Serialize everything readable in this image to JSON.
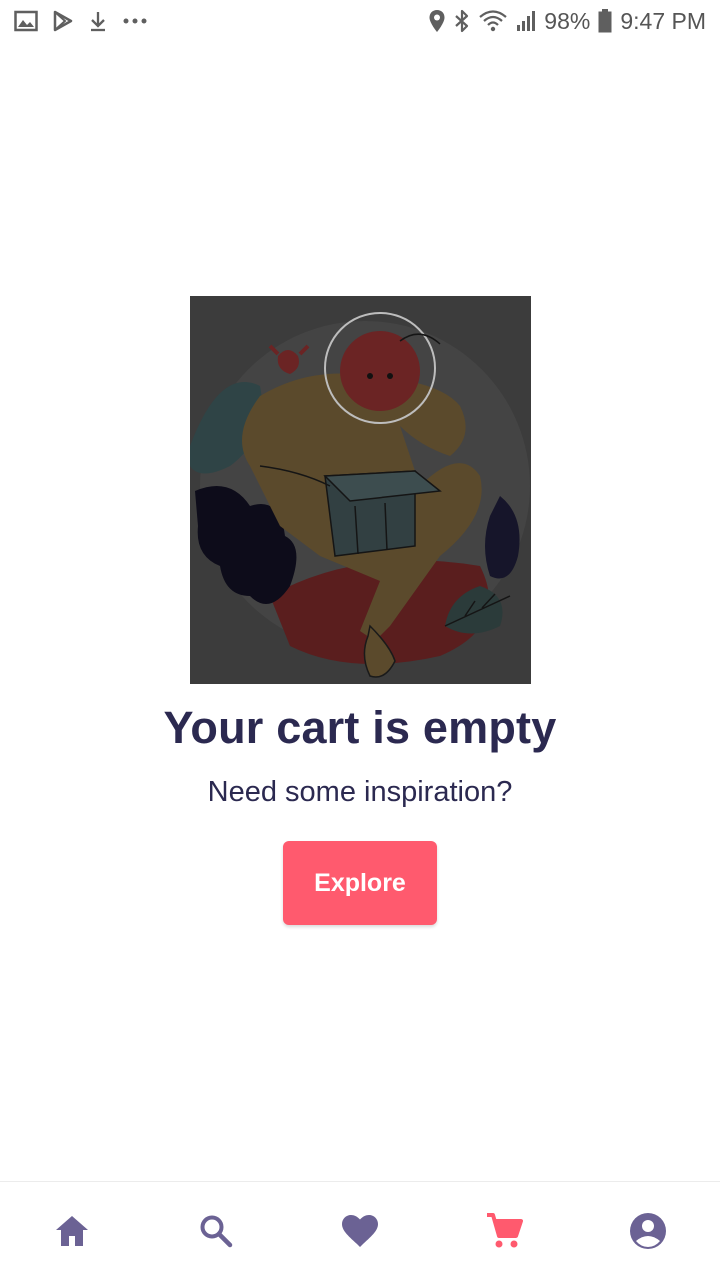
{
  "status_bar": {
    "battery_percent": "98%",
    "time": "9:47 PM",
    "left_icons": [
      "gallery-icon",
      "play-store-icon",
      "download-icon",
      "more-dots-icon"
    ],
    "right_icons": [
      "location-icon",
      "bluetooth-icon",
      "wifi-icon",
      "signal-icon",
      "battery-icon"
    ]
  },
  "empty_cart": {
    "title": "Your cart is empty",
    "subtitle": "Need some inspiration?",
    "button_label": "Explore",
    "illustration": "astronaut-opening-box-illustration"
  },
  "bottom_nav": {
    "items": [
      {
        "name": "home",
        "icon": "home-icon",
        "active": false
      },
      {
        "name": "search",
        "icon": "search-icon",
        "active": false
      },
      {
        "name": "favorites",
        "icon": "heart-icon",
        "active": false
      },
      {
        "name": "cart",
        "icon": "cart-icon",
        "active": true
      },
      {
        "name": "profile",
        "icon": "account-icon",
        "active": false
      }
    ]
  },
  "colors": {
    "accent": "#ff5a6e",
    "text_primary": "#2b2950",
    "nav_inactive": "#6b6294"
  }
}
